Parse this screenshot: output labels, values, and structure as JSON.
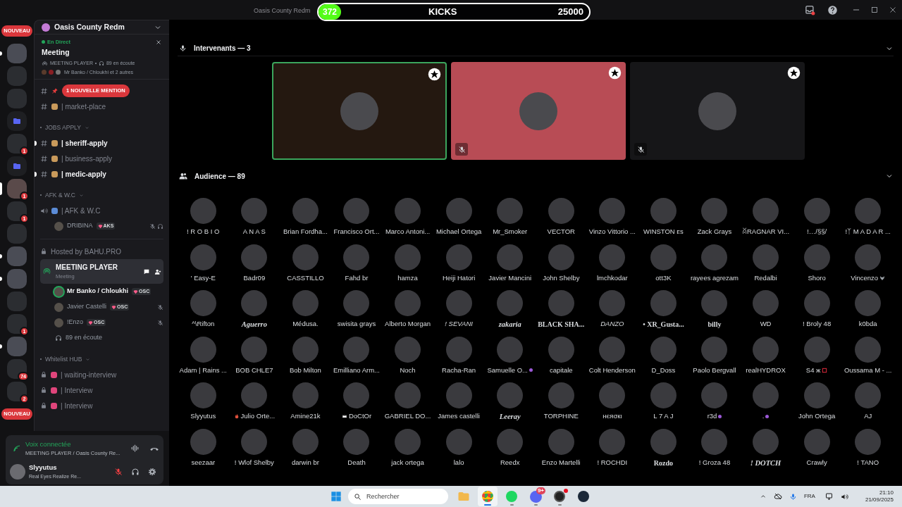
{
  "window": {
    "title": "Oasis County Redm"
  },
  "kicks_widget": {
    "count": "372",
    "label": "KICKS",
    "goal": "25000",
    "level": 0.015
  },
  "server_rail": [
    {
      "kind": "pill",
      "label": "NOUVEAU"
    },
    {
      "kind": "server",
      "unread": true,
      "selected": false
    },
    {
      "kind": "server",
      "unread": false,
      "selected": false
    },
    {
      "kind": "server",
      "unread": false,
      "selected": false
    },
    {
      "kind": "folder",
      "unread": false,
      "selected": false
    },
    {
      "kind": "server",
      "unread": false,
      "selected": false,
      "badge": "1"
    },
    {
      "kind": "folder",
      "unread": false,
      "selected": false
    },
    {
      "kind": "server",
      "unread": false,
      "selected": true,
      "badge": "1"
    },
    {
      "kind": "server",
      "unread": false,
      "selected": false,
      "badge": "1"
    },
    {
      "kind": "server",
      "unread": false,
      "selected": false
    },
    {
      "kind": "server",
      "unread": true,
      "selected": false
    },
    {
      "kind": "server",
      "unread": true,
      "selected": false
    },
    {
      "kind": "server",
      "unread": false,
      "selected": false
    },
    {
      "kind": "server",
      "unread": false,
      "selected": false,
      "badge": "1"
    },
    {
      "kind": "server",
      "unread": true,
      "selected": false
    },
    {
      "kind": "server",
      "unread": false,
      "selected": false,
      "badge": "74"
    },
    {
      "kind": "server",
      "unread": false,
      "selected": false,
      "badge": "2"
    },
    {
      "kind": "pill",
      "label": "NOUVEAU"
    }
  ],
  "server_header": {
    "name": "Oasis County Redm"
  },
  "live_card": {
    "status": "En Direct",
    "title": "Meeting",
    "channel": "MEETING PLAYER",
    "listeners": "89 en écoute",
    "participants": "Mr Banko / Chloukhi et 2 autres"
  },
  "channels": [
    {
      "kind": "mention",
      "label": "1 NOUVELLE MENTION"
    },
    {
      "kind": "text",
      "name": "| market-place",
      "unread": false
    },
    {
      "kind": "category",
      "name": "JOBS APPLY"
    },
    {
      "kind": "text",
      "name": "| sheriff-apply",
      "unread": true
    },
    {
      "kind": "text",
      "name": "| business-apply",
      "unread": false
    },
    {
      "kind": "text",
      "name": "| medic-apply",
      "unread": true
    },
    {
      "kind": "category",
      "name": "AFK & W.C"
    },
    {
      "kind": "voice",
      "name": "| AFK & W.C",
      "selected": false
    },
    {
      "kind": "member",
      "name": "DRIBINA",
      "tag": "AKS",
      "speaking": false,
      "muted": true,
      "deafened": true
    },
    {
      "kind": "divider"
    },
    {
      "kind": "locked_label",
      "name": "Hosted by BAHU.PRO"
    },
    {
      "kind": "voice",
      "name": "MEETING PLAYER",
      "subtitle": "Meeting",
      "selected": true
    },
    {
      "kind": "member",
      "name": "Mr Banko / Chloukhi",
      "tag": "OSC",
      "speaking": true,
      "muted": false,
      "deafened": false
    },
    {
      "kind": "member",
      "name": "Javier Castelli",
      "tag": "OSC",
      "speaking": false,
      "muted": true,
      "deafened": false
    },
    {
      "kind": "member",
      "name": "!Enzo",
      "tag": "OSC",
      "speaking": false,
      "muted": true,
      "deafened": false
    },
    {
      "kind": "listeners",
      "label": "89 en écoute"
    },
    {
      "kind": "category",
      "name": "Whitelist HUB"
    },
    {
      "kind": "locked_channel",
      "name": "| waiting-interview"
    },
    {
      "kind": "locked_channel",
      "name": "| Interview"
    },
    {
      "kind": "locked_channel",
      "name": "| Interview"
    }
  ],
  "voice_status": {
    "title": "Voix connectée",
    "channel": "MEETING PLAYER / Oasis County Re..."
  },
  "user": {
    "name": "Slyyutus",
    "status": "Real Eyes Realize Re...",
    "mic_muted": true
  },
  "stage": {
    "speakers_title": "Intervenants — 3",
    "speakers": [
      {
        "color": "#241810",
        "speaking": true,
        "muted": false
      },
      {
        "color": "#b84c55",
        "speaking": false,
        "muted": true
      },
      {
        "color": "#161618",
        "speaking": false,
        "muted": true
      }
    ],
    "audience_title": "Audience — 89",
    "audience": [
      {
        "name": "! R O B I O"
      },
      {
        "name": "A N A S"
      },
      {
        "name": "Brian Fordha..."
      },
      {
        "name": "Francisco Ort..."
      },
      {
        "name": "Marco Antoni..."
      },
      {
        "name": "Michael Ortega"
      },
      {
        "name": "Mr_Smoker"
      },
      {
        "name": "VECTOR"
      },
      {
        "name": "Vinzo Vittorio ..."
      },
      {
        "name": "WINSTON ᴇs"
      },
      {
        "name": "Zack Grays"
      },
      {
        "name": "ꊼRAGNAR VI..."
      },
      {
        "name": "!…/§§/"
      },
      {
        "name": "!ᛉ M A D A R ..."
      },
      {
        "name": "' Easy-E"
      },
      {
        "name": "Badr09"
      },
      {
        "name": "CASSTILLO"
      },
      {
        "name": "Fahd br"
      },
      {
        "name": "hamza"
      },
      {
        "name": "Heiji Hatori"
      },
      {
        "name": "Javier Mancini"
      },
      {
        "name": "John Shelby"
      },
      {
        "name": "lmchkodar"
      },
      {
        "name": "ott3K"
      },
      {
        "name": "rayees agrezam"
      },
      {
        "name": "Redalbi"
      },
      {
        "name": "Shoro"
      },
      {
        "name": "Vincenzo",
        "kind": "wolf-suffix"
      },
      {
        "name": "^\\Rifton"
      },
      {
        "name": "Aguerro",
        "kind": "script"
      },
      {
        "name": "Médusa."
      },
      {
        "name": "swisita grays"
      },
      {
        "name": "Alberto Morgan"
      },
      {
        "name": "! SEVANI",
        "kind": "slanted"
      },
      {
        "name": "zakaria",
        "kind": "script"
      },
      {
        "name": "BLACK SHA...",
        "kind": "serif"
      },
      {
        "name": "DANZO",
        "kind": "slanted"
      },
      {
        "name": "• XR_Gusta...",
        "kind": "serif"
      },
      {
        "name": "billy",
        "kind": "serif"
      },
      {
        "name": "WD"
      },
      {
        "name": "! Broly 48"
      },
      {
        "name": "k0bda"
      },
      {
        "name": "Adam | Rains ..."
      },
      {
        "name": "BOB CHLE7"
      },
      {
        "name": "Bob Milton"
      },
      {
        "name": "Emilliano Arm..."
      },
      {
        "name": "Noch"
      },
      {
        "name": "Racha-Ran"
      },
      {
        "name": "Samuelle O...",
        "kind": "booster"
      },
      {
        "name": "capitale"
      },
      {
        "name": "Colt Henderson"
      },
      {
        "name": "D_Doss"
      },
      {
        "name": "Paolo Bergvall"
      },
      {
        "name": "realHYDROX"
      },
      {
        "name": "S4 ж",
        "kind": "frame-suffix"
      },
      {
        "name": "Oussama M - ..."
      },
      {
        "name": "Slyyutus"
      },
      {
        "name": "Julio Orte...",
        "kind": "flame-prefix"
      },
      {
        "name": "Amine21k"
      },
      {
        "name": "DoCtOr",
        "kind": "crown-prefix"
      },
      {
        "name": "GABRIEL DO..."
      },
      {
        "name": "James castelli"
      },
      {
        "name": "Leeray",
        "kind": "script"
      },
      {
        "name": "TORPHINE"
      },
      {
        "name": "нєяσкι"
      },
      {
        "name": "L 7 A J"
      },
      {
        "name": "r3d",
        "kind": "booster"
      },
      {
        "name": ".",
        "kind": "booster"
      },
      {
        "name": "John Ortega"
      },
      {
        "name": "AJ"
      },
      {
        "name": "seezaar"
      },
      {
        "name": "! Wlof Shelby"
      },
      {
        "name": "darwin br"
      },
      {
        "name": "Death"
      },
      {
        "name": "jack ortega"
      },
      {
        "name": "lalo"
      },
      {
        "name": "Reedx"
      },
      {
        "name": "Enzo Martelli"
      },
      {
        "name": "! ROCHDI"
      },
      {
        "name": "Rozdo",
        "kind": "serif"
      },
      {
        "name": "! Groza 48"
      },
      {
        "name": "! DOTCH",
        "kind": "script"
      },
      {
        "name": "Crawly"
      },
      {
        "name": "! TANO"
      }
    ]
  },
  "taskbar": {
    "search": {
      "placeholder": "Rechercher"
    },
    "apps": [
      {
        "kind": "folder",
        "selected": false,
        "running": false,
        "notification": false
      },
      {
        "kind": "browser",
        "selected": true,
        "running": true,
        "notification": false
      },
      {
        "kind": "music",
        "selected": false,
        "running": true,
        "notification": false
      },
      {
        "kind": "chat",
        "selected": false,
        "running": true,
        "notification": false,
        "badge": "9+"
      },
      {
        "kind": "recorder",
        "selected": false,
        "running": true,
        "notification": true
      },
      {
        "kind": "game",
        "selected": false,
        "running": false,
        "notification": false
      }
    ],
    "language": "FRA",
    "time": "21:10",
    "date": "21/09/2025"
  }
}
